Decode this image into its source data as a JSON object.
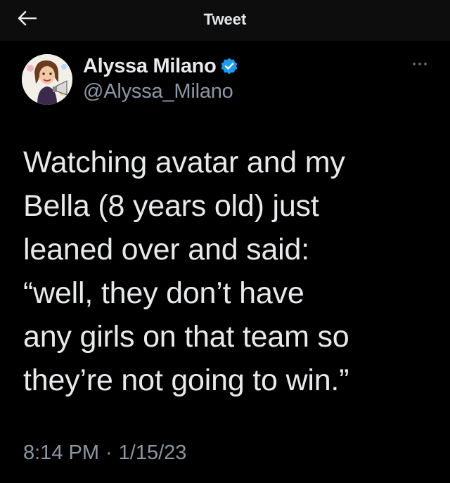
{
  "header": {
    "title": "Tweet",
    "back_icon": "arrow-left-icon"
  },
  "tweet": {
    "author": {
      "display_name": "Alyssa Milano",
      "handle": "@Alyssa_Milano",
      "verified": true,
      "verified_icon": "verified-badge-icon",
      "avatar_icon": "avatar-caricature"
    },
    "more_icon": "more-options-icon",
    "text": "Watching avatar and my\nBella (8 years old) just\nleaned over and said:\n“well, they don’t have\nany girls on that team so\nthey’re not going to win.”",
    "time": "8:14 PM",
    "separator": "·",
    "date": "1/15/23"
  },
  "colors": {
    "background": "#000000",
    "header_background": "#0d0d0d",
    "primary_text": "#e7e9ea",
    "secondary_text": "#8b98a5",
    "verified_blue": "#1d9bf0"
  }
}
